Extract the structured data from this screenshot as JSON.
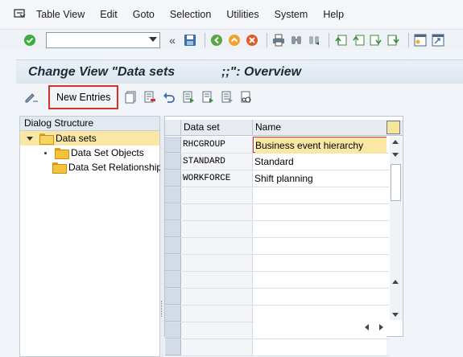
{
  "menu": {
    "items": [
      {
        "label": "Table View"
      },
      {
        "label": "Edit"
      },
      {
        "label": "Goto"
      },
      {
        "label": "Selection"
      },
      {
        "label": "Utilities"
      },
      {
        "label": "System"
      },
      {
        "label": "Help"
      }
    ]
  },
  "toolbar": {
    "command_field_value": "",
    "icons": [
      "enter-icon",
      "save-icon",
      "back-icon",
      "exit-icon",
      "cancel-icon",
      "print-icon",
      "find-icon",
      "find-next-icon",
      "first-page-icon",
      "previous-page-icon",
      "next-page-icon",
      "last-page-icon",
      "create-session-icon",
      "shortcut-icon"
    ]
  },
  "page": {
    "title": "Change View \"Data sets             ;;\": Overview"
  },
  "app_toolbar": {
    "new_entries_label": "New Entries"
  },
  "dialog_structure": {
    "header": "Dialog Structure",
    "root": {
      "label": "Data sets",
      "selected": true,
      "expanded": true
    },
    "children": [
      {
        "label": "Data Set Objects"
      },
      {
        "label": "Data Set Relationships"
      }
    ]
  },
  "table": {
    "columns": [
      "Data set",
      "Name"
    ],
    "rows": [
      {
        "key": "RHCGROUP",
        "name": "Business event hierarchy",
        "active": true
      },
      {
        "key": "STANDARD",
        "name": "Standard",
        "active": false
      },
      {
        "key": "WORKFORCE",
        "name": "Shift planning",
        "active": false
      }
    ],
    "empty_rows": 10
  },
  "colors": {
    "selection_yellow": "#fbe7a5",
    "highlight_red": "#d0342c",
    "title_text": "#1d2a3a"
  }
}
